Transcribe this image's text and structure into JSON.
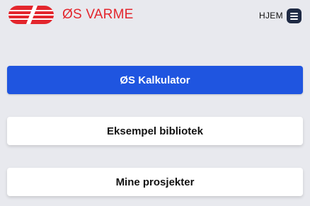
{
  "header": {
    "brand_name": "ØS VARME",
    "logo_icon": "os-varme-logo-icon",
    "nav_home": "HJEM",
    "menu_icon": "hamburger-menu-icon"
  },
  "colors": {
    "brand_red": "#e3262d",
    "primary_blue": "#1f55e0",
    "background": "#e8e9ee"
  },
  "main": {
    "buttons": [
      {
        "label": "ØS Kalkulator"
      },
      {
        "label": "Eksempel bibliotek"
      },
      {
        "label": "Mine prosjekter"
      }
    ]
  }
}
